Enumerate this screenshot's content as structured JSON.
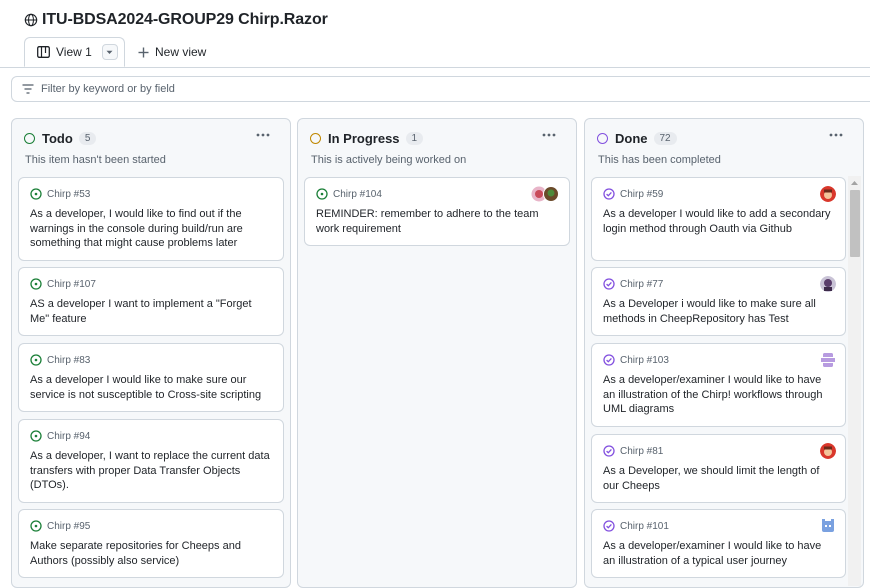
{
  "project": {
    "title": "ITU-BDSA2024-GROUP29 Chirp.Razor"
  },
  "tabs": {
    "active_label": "View 1",
    "new_view_label": "New view"
  },
  "filter": {
    "placeholder": "Filter by keyword or by field"
  },
  "colors": {
    "todo": "#1a7f37",
    "in_progress": "#bf8700",
    "done": "#8250df",
    "border": "#d0d7de",
    "column_bg": "#f6f8fa",
    "muted_text": "#59636e"
  },
  "columns": [
    {
      "name": "Todo",
      "count": "5",
      "description": "This item hasn't been started",
      "status_color": "#1a7f37",
      "cards": [
        {
          "ref": "Chirp #53",
          "title": "As a developer, I would like to find out if the warnings in the console during build/run are something that might cause problems later",
          "icon": "issue-open-icon"
        },
        {
          "ref": "Chirp #107",
          "title": "AS a developer I want to implement a \"Forget Me\" feature",
          "icon": "issue-open-icon"
        },
        {
          "ref": "Chirp #83",
          "title": "As a developer I would like to make sure our service is not susceptible to Cross-site scripting",
          "icon": "issue-open-icon"
        },
        {
          "ref": "Chirp #94",
          "title": "As a developer, I want to replace the current data transfers with proper Data Transfer Objects (DTOs).",
          "icon": "issue-open-icon"
        },
        {
          "ref": "Chirp #95",
          "title": "Make separate repositories for Cheeps and Authors (possibly also service)",
          "icon": "issue-open-icon"
        }
      ]
    },
    {
      "name": "In Progress",
      "count": "1",
      "description": "This is actively being worked on",
      "status_color": "#bf8700",
      "cards": [
        {
          "ref": "Chirp #104",
          "title": "REMINDER: remember to adhere to the team work requirement",
          "icon": "issue-open-icon"
        }
      ]
    },
    {
      "name": "Done",
      "count": "72",
      "description": "This has been completed",
      "status_color": "#8250df",
      "cards": [
        {
          "ref": "Chirp #59",
          "title": "As a developer I would like to add a secondary login method through Oauth via Github",
          "icon": "issue-closed-icon"
        },
        {
          "ref": "Chirp #77",
          "title": "As a Developer i would like to make sure all methods in CheepRepository has Test",
          "icon": "issue-closed-icon"
        },
        {
          "ref": "Chirp #103",
          "title": "As a developer/examiner I would like to have an illustration of the Chirp! workflows through UML diagrams",
          "icon": "issue-closed-icon"
        },
        {
          "ref": "Chirp #81",
          "title": "As a Developer, we should limit the length of our Cheeps",
          "icon": "issue-closed-icon"
        },
        {
          "ref": "Chirp #101",
          "title": "As a developer/examiner I would like to have an illustration of a typical user journey",
          "icon": "issue-closed-icon"
        }
      ]
    }
  ]
}
